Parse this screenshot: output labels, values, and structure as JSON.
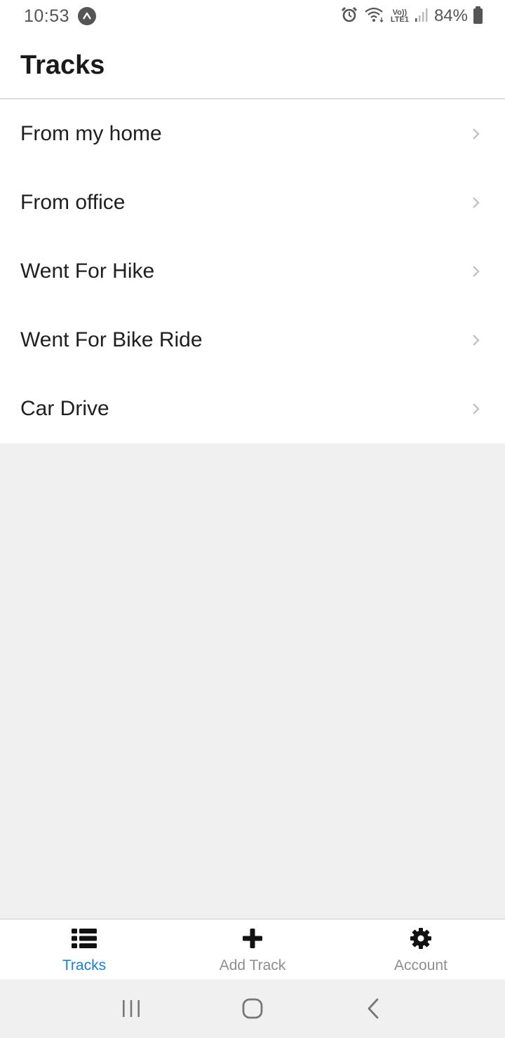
{
  "status_bar": {
    "time": "10:53",
    "battery_percent": "84%",
    "network_label": "LTE1",
    "volte_label": "Vo))",
    "icons": [
      "alarm-icon",
      "wifi-icon",
      "volte-icon",
      "signal-icon",
      "battery-icon"
    ]
  },
  "header": {
    "title": "Tracks"
  },
  "tracks": [
    {
      "label": "From my home"
    },
    {
      "label": "From office"
    },
    {
      "label": "Went For Hike"
    },
    {
      "label": "Went For Bike Ride"
    },
    {
      "label": "Car Drive"
    }
  ],
  "tab_bar": {
    "tabs": [
      {
        "label": "Tracks",
        "icon": "list-icon",
        "active": true
      },
      {
        "label": "Add Track",
        "icon": "plus-icon",
        "active": false
      },
      {
        "label": "Account",
        "icon": "gear-icon",
        "active": false
      }
    ]
  },
  "nav_bar": {
    "buttons": [
      "recent-apps-icon",
      "home-icon",
      "back-icon"
    ]
  },
  "colors": {
    "accent": "#1a7ed4",
    "inactive_tab": "#8e8e8e",
    "background": "#f0f0f0"
  }
}
